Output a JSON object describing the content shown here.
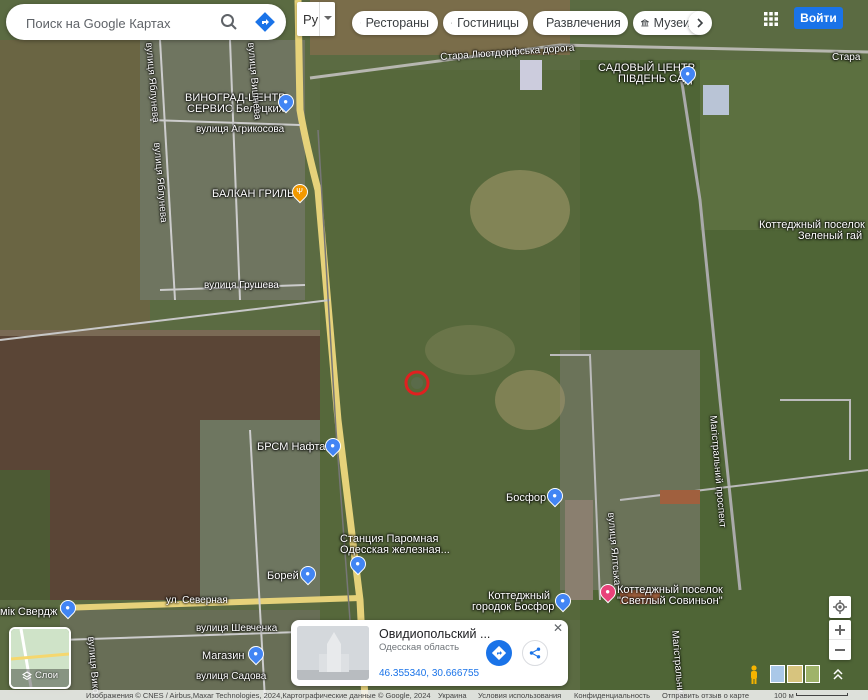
{
  "search": {
    "placeholder": "Поиск на Google Картах"
  },
  "language": "Ру",
  "chips": [
    {
      "label": "Рестораны",
      "icon": "fork-knife-icon"
    },
    {
      "label": "Гостиницы",
      "icon": "bed-icon"
    },
    {
      "label": "Развлечения",
      "icon": "camera-icon"
    },
    {
      "label": "Музеи",
      "icon": "museum-icon"
    }
  ],
  "login": "Войти",
  "map_labels": {
    "vinograd": "ВИНОГРАД-ЦЕНТР",
    "vinograd2": "СЕРВИС Белецких",
    "agricosova": "вулиця Агрикосова",
    "balkan": "БАЛКАН ГРИЛЬ",
    "grusheva": "вулиця Грушева",
    "brsm": "БРСМ Нафта",
    "stanciya": "Станция Паромная",
    "stanciya2": "Одесская железная...",
    "borei": "Борей",
    "severnaya": "ул. Северная",
    "shevchenka": "вулиця Шевченка",
    "magazin": "Магазин",
    "sadova": "вулиця Садова",
    "mik": "мік Свердж",
    "bosfor": "Босфор",
    "kottedzh_bosfor": "Коттеджный",
    "kottedzh_bosfor2": "городок Босфор",
    "svetly": "Коттеджный поселок",
    "svetly2": "\"Светлый Совиньон\"",
    "zeleny": "Коттеджный поселок",
    "zeleny2": "Зеленый гай",
    "sad": "САДОВЫЙ ЦЕНТР",
    "sad2": "ПІВДЕНЬ САД",
    "lustdorf": "Стара Люстдорфська дорога",
    "stara": "Стара",
    "magistral": "Магістральний проспект",
    "magistral2": "Магістральний",
    "yablunevaya": "вулиця Яблунева",
    "vishneva": "вулиця Вишнева",
    "yablunevaya2": "вулиця Яблунева",
    "yaltska": "вулиця Ялтська",
    "vikonta": "вулиця Викон"
  },
  "layers": {
    "label": "Слои"
  },
  "place_card": {
    "title": "Овидиопольский ...",
    "subtitle": "Одесская область",
    "coords": "46.355340, 30.666755"
  },
  "footer": {
    "imagery": "Изображения © CNES / Airbus,Maxar Technologies, 2024,Картографические данные © Google, 2024",
    "country": "Украина",
    "terms": "Условия использования",
    "privacy": "Конфиденциальность",
    "feedback": "Отправить отзыв о карте",
    "scale": "100 м"
  }
}
